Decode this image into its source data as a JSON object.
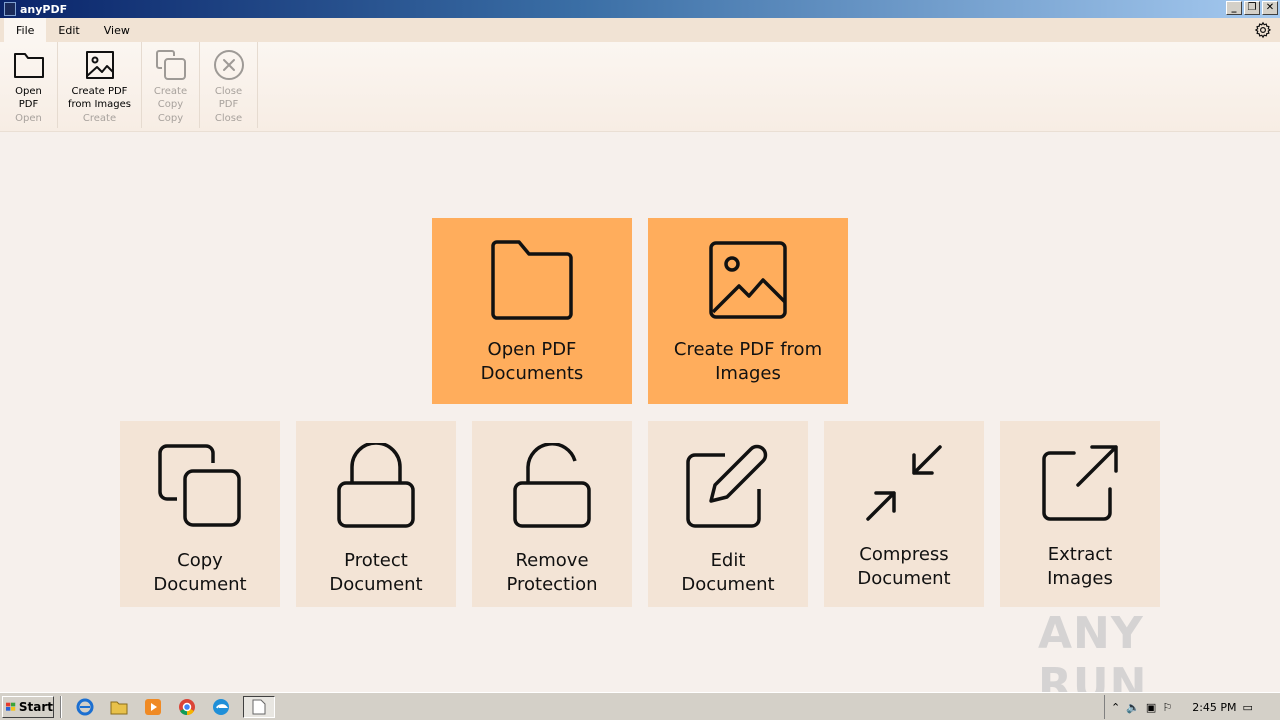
{
  "window": {
    "title": "anyPDF"
  },
  "menu": {
    "tabs": [
      "File",
      "Edit",
      "View"
    ]
  },
  "ribbon": {
    "groups": [
      {
        "name": "Open",
        "button": "Open\nPDF",
        "enabled": true,
        "icon": "folder-icon"
      },
      {
        "name": "Create",
        "button": "Create PDF\nfrom Images",
        "enabled": true,
        "icon": "image-icon"
      },
      {
        "name": "Copy",
        "button": "Create\nCopy",
        "enabled": false,
        "icon": "copy-icon"
      },
      {
        "name": "Close",
        "button": "Close\nPDF",
        "enabled": false,
        "icon": "close-circle-icon"
      }
    ]
  },
  "tiles": {
    "primary": [
      {
        "label": "Open PDF\nDocuments",
        "icon": "folder-icon"
      },
      {
        "label": "Create PDF from\nImages",
        "icon": "image-icon"
      }
    ],
    "secondary": [
      {
        "label": "Copy\nDocument",
        "icon": "copy-icon"
      },
      {
        "label": "Protect\nDocument",
        "icon": "lock-icon"
      },
      {
        "label": "Remove\nProtection",
        "icon": "unlock-icon"
      },
      {
        "label": "Edit\nDocument",
        "icon": "edit-icon"
      },
      {
        "label": "Compress\nDocument",
        "icon": "compress-icon"
      },
      {
        "label": "Extract\nImages",
        "icon": "external-link-icon"
      }
    ]
  },
  "taskbar": {
    "start_label": "Start",
    "clock": "2:45 PM"
  },
  "watermark": {
    "text": "ANY RUN"
  },
  "colors": {
    "primary_tile": "#ffad5c",
    "secondary_tile": "#f3e4d6",
    "background": "#f6f0ec"
  }
}
